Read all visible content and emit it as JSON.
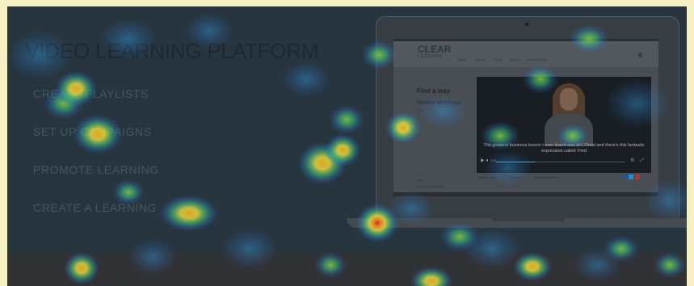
{
  "hero": {
    "headline": "VIDEO LEARNING PLATFORM",
    "menu": [
      {
        "label": "CREATE PLAYLISTS"
      },
      {
        "label": "SET UP CAMPAIGNS"
      },
      {
        "label": "PROMOTE LEARNING"
      },
      {
        "label": "CREATE A LEARNING"
      }
    ]
  },
  "laptop_site": {
    "brand_top": "CLEAR",
    "brand_bottom": "LESSONS",
    "nav": [
      "Home",
      "Browse",
      "Topics",
      "Library",
      "Learning Paths"
    ],
    "page_title": "Find a way",
    "author": "Helena Morrissey",
    "author_role": "CBE",
    "caption": "The greatest business lesson I ever learnt was at L'Oréal and there's this fantastic expression called 'Find",
    "time_label": "0:00",
    "progress_fraction": 0.3,
    "actions": [
      "Watch Later",
      "Favourite",
      "Remember Point"
    ],
    "share_colors": [
      "#3b5998",
      "#1da1f2",
      "#c0392b"
    ],
    "meta_left": "Topic",
    "meta_right": "Learn more about this"
  },
  "colors": {
    "page_bg": "#f6efc2",
    "hero_bg": "#2b3a44",
    "lower_bar": "#353638",
    "headline": "#1f2a31",
    "menu": "#48606c",
    "accent_progress": "#6fb3d6"
  },
  "heatmap": {
    "palette": [
      "#2f7fd8",
      "#3fd48a",
      "#f2e23a",
      "#f28b1f",
      "#e8232c"
    ]
  }
}
